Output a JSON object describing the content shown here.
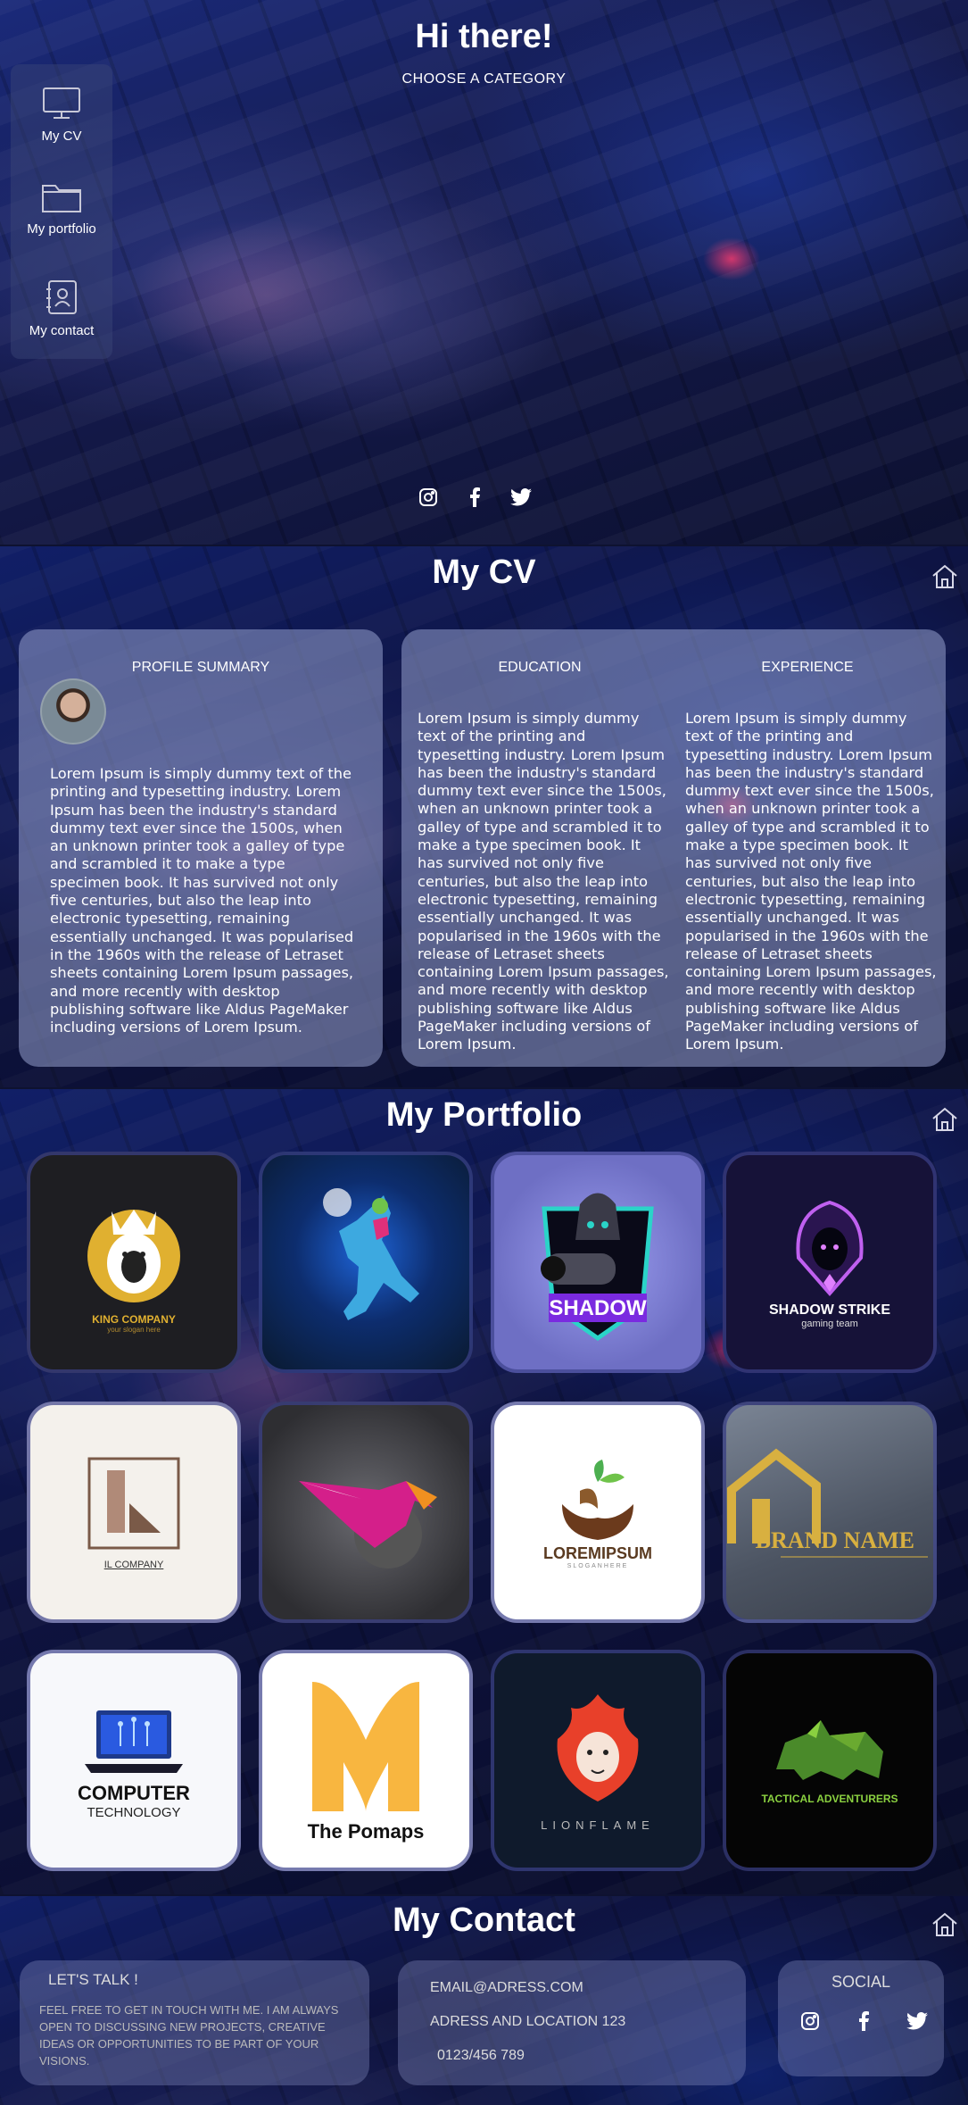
{
  "hero": {
    "title": "Hi there!",
    "subtitle": "CHOOSE A CATEGORY",
    "menu": [
      {
        "label": "My CV",
        "icon": "monitor-icon"
      },
      {
        "label": "My portfolio",
        "icon": "folder-icon"
      },
      {
        "label": "My contact",
        "icon": "contact-book-icon"
      }
    ],
    "social": [
      "instagram-icon",
      "facebook-icon",
      "twitter-icon"
    ]
  },
  "cv": {
    "title": "My CV",
    "profile_heading": "PROFILE SUMMARY",
    "profile_text": "Lorem Ipsum is simply dummy text of the printing and typesetting industry. Lorem Ipsum has been the industry's standard dummy text ever since the 1500s, when an unknown printer took a galley of type and scrambled it to make a type specimen book. It has survived not only five centuries, but also the leap into electronic typesetting, remaining essentially unchanged. It was popularised in the 1960s with the release of Letraset sheets containing Lorem Ipsum passages, and more recently with desktop publishing software like Aldus PageMaker including versions of Lorem Ipsum.",
    "education_heading": "EDUCATION",
    "education_text": "Lorem Ipsum is simply dummy text of the printing and typesetting industry. Lorem Ipsum has been the industry's standard dummy text ever since the 1500s, when an unknown printer took a galley of type and scrambled it to make a type specimen book. It has survived not only five centuries, but also the leap into electronic typesetting, remaining essentially unchanged. It was popularised in the 1960s with the release of Letraset sheets containing Lorem Ipsum passages, and more recently with desktop publishing software like Aldus PageMaker including versions of Lorem Ipsum.",
    "experience_heading": "EXPERIENCE",
    "experience_text": "Lorem Ipsum is simply dummy text of the printing and typesetting industry. Lorem Ipsum has been the industry's standard dummy text ever since the 1500s, when an unknown printer took a galley of type and scrambled it to make a type specimen book. It has survived not only five centuries, but also the leap into electronic typesetting, remaining essentially unchanged. It was popularised in the 1960s with the release of Letraset sheets containing Lorem Ipsum passages, and more recently with desktop publishing software like Aldus PageMaker including versions of Lorem Ipsum."
  },
  "portfolio": {
    "title": "My Portfolio",
    "tiles": [
      {
        "caption": "KING COMPANY",
        "sub": "your slogan here",
        "bg": "#1e1e22"
      },
      {
        "caption": "",
        "sub": "",
        "bg": "#0d2340"
      },
      {
        "caption": "SHADOW",
        "sub": "",
        "bg": "#6e6fc4"
      },
      {
        "caption": "SHADOW STRIKE",
        "sub": "gaming team",
        "bg": "#161238"
      },
      {
        "caption": "IL COMPANY",
        "sub": "",
        "bg": "#f4f1ec"
      },
      {
        "caption": "",
        "sub": "",
        "bg": "#3a3a3e"
      },
      {
        "caption": "LOREMIPSUM",
        "sub": "SLOGANHERE",
        "bg": "#ffffff"
      },
      {
        "caption": "BRAND NAME",
        "sub": "",
        "bg": "#5c6472"
      },
      {
        "caption": "COMPUTER",
        "sub": "TECHNOLOGY",
        "bg": "#f7f8fb"
      },
      {
        "caption": "The Pomaps",
        "sub": "",
        "bg": "#ffffff"
      },
      {
        "caption": "LIONFLAME",
        "sub": "",
        "bg": "#0f1a2c"
      },
      {
        "caption": "TACTICAL ADVENTURERS",
        "sub": "",
        "bg": "#050505"
      }
    ]
  },
  "contact": {
    "title": "My Contact",
    "talk_heading": "LET'S TALK !",
    "talk_text": "FEEL FREE TO GET IN TOUCH WITH ME. I AM ALWAYS OPEN TO DISCUSSING NEW PROJECTS, CREATIVE IDEAS OR OPPORTUNITIES TO BE PART OF YOUR VISIONS.",
    "email": "EMAIL@ADRESS.COM",
    "address": "ADRESS AND LOCATION 123",
    "phone": "0123/456 789",
    "social_heading": "SOCIAL"
  }
}
